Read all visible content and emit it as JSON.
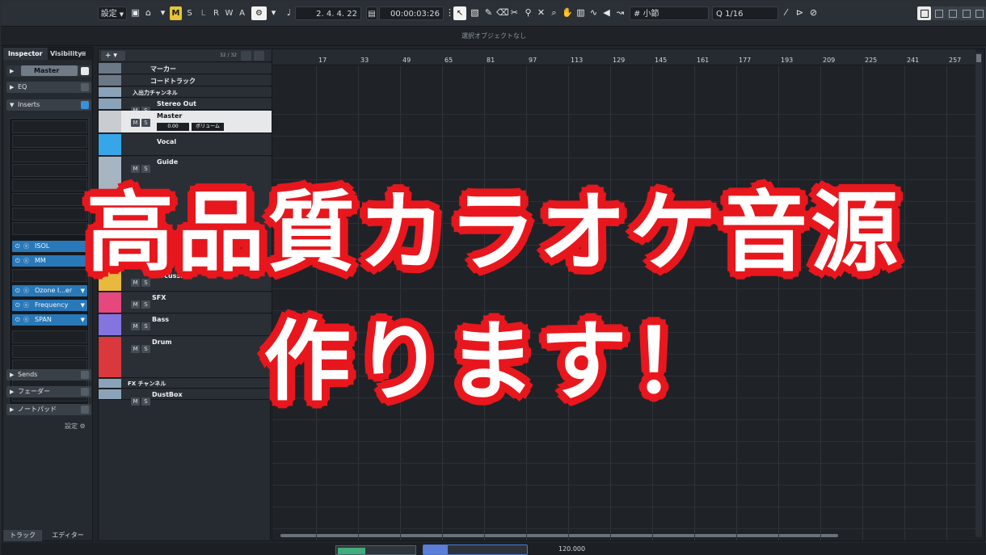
{
  "toolbar": {
    "settings_label": "設定",
    "mode_buttons": [
      "M",
      "S",
      "L",
      "R",
      "W",
      "A"
    ],
    "position": "2. 4. 4. 22",
    "time": "00:00:03:26",
    "grid_type": "小節",
    "quantize": "1/16"
  },
  "info_line": "選択オブジェクトなし",
  "inspector": {
    "tab_inspector": "Inspector",
    "tab_visibility": "Visibility",
    "channel": "Master",
    "eq": "EQ",
    "inserts": "Inserts",
    "plugins": [
      {
        "label": "ISOL"
      },
      {
        "label": "MM"
      },
      {
        "label": "Ozone I...er"
      },
      {
        "label": "Frequency"
      },
      {
        "label": "SPAN"
      }
    ],
    "sends": "Sends",
    "fader": "フェーダー",
    "notepad": "ノートパッド",
    "settings": "設定",
    "bottom_tab_track": "トラック",
    "bottom_tab_editor": "エディター"
  },
  "tracklist": {
    "count": "32 / 32",
    "tracks": [
      {
        "name": "マーカー",
        "color": "#6b7885"
      },
      {
        "name": "コードトラック",
        "color": "#6b7885"
      },
      {
        "name": "入出力チャンネル",
        "color": "#8aa3b8"
      },
      {
        "name": "Stereo Out",
        "color": "#8aa3b8"
      },
      {
        "name": "Master",
        "color": "#d8dbe0",
        "volume": "0.00",
        "volume_label": "ボリューム"
      },
      {
        "name": "Vocal",
        "color": "#36a6e8"
      },
      {
        "name": "Guide",
        "color": "#a7b4c2"
      },
      {
        "name": "Percussion",
        "color": "#e8b93c"
      },
      {
        "name": "SFX",
        "color": "#e6477d"
      },
      {
        "name": "Bass",
        "color": "#8474e0"
      },
      {
        "name": "Drum",
        "color": "#d9383c"
      },
      {
        "name": "FX チャンネル",
        "color": "#8aa3b8"
      },
      {
        "name": "DustBox",
        "color": "#8aa3b8"
      }
    ]
  },
  "ruler": {
    "ticks": [
      "17",
      "33",
      "49",
      "65",
      "81",
      "97",
      "113",
      "129",
      "145",
      "161",
      "177",
      "193",
      "209",
      "225",
      "241",
      "257"
    ]
  },
  "transport": {
    "tempo": "120.000"
  },
  "overlay": {
    "line1": "高品質カラオケ音源",
    "line2": "作ります！"
  }
}
